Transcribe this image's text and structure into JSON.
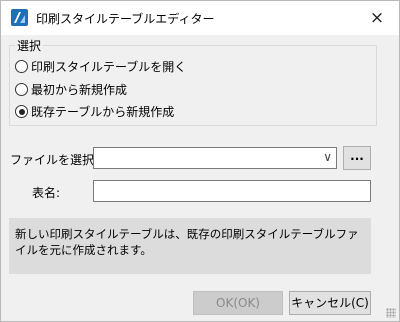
{
  "window": {
    "title": "印刷スタイルテーブルエディター",
    "close_glyph": "×",
    "app_icon": "app-logo-icon"
  },
  "selection_group": {
    "label": "選択",
    "options": [
      {
        "label": "印刷スタイルテーブルを開く",
        "checked": false
      },
      {
        "label": "最初から新規作成",
        "checked": false
      },
      {
        "label": "既存テーブルから新規作成",
        "checked": true
      }
    ]
  },
  "file_select": {
    "label": "ファイルを選択:",
    "value": "",
    "dropdown_glyph": "∨",
    "browse_label": "..."
  },
  "table_name": {
    "label": "表名:",
    "value": ""
  },
  "info_text": "新しい印刷スタイルテーブルは、既存の印刷スタイルテーブルファイルを元に作成されます。",
  "buttons": {
    "ok": "OK(OK)",
    "ok_enabled": false,
    "cancel": "キャンセル(C)"
  }
}
